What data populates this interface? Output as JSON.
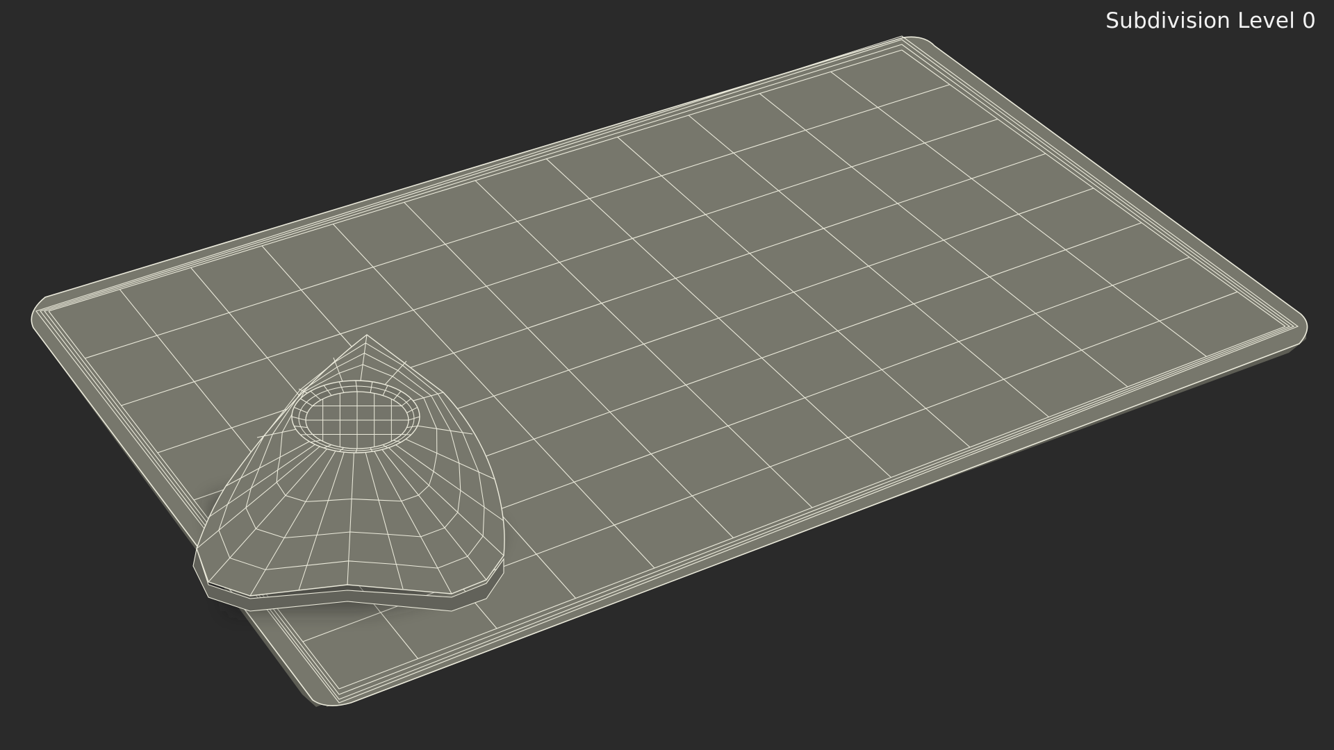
{
  "viewport": {
    "background": "#2a2a2a",
    "label": "Subdivision Level 0"
  },
  "model": {
    "surface_color": "#77776c",
    "wire_color": "#ecebdc",
    "shadow_color": "#1c1c1a",
    "objects": [
      "card-plate",
      "pick-with-ring"
    ]
  }
}
